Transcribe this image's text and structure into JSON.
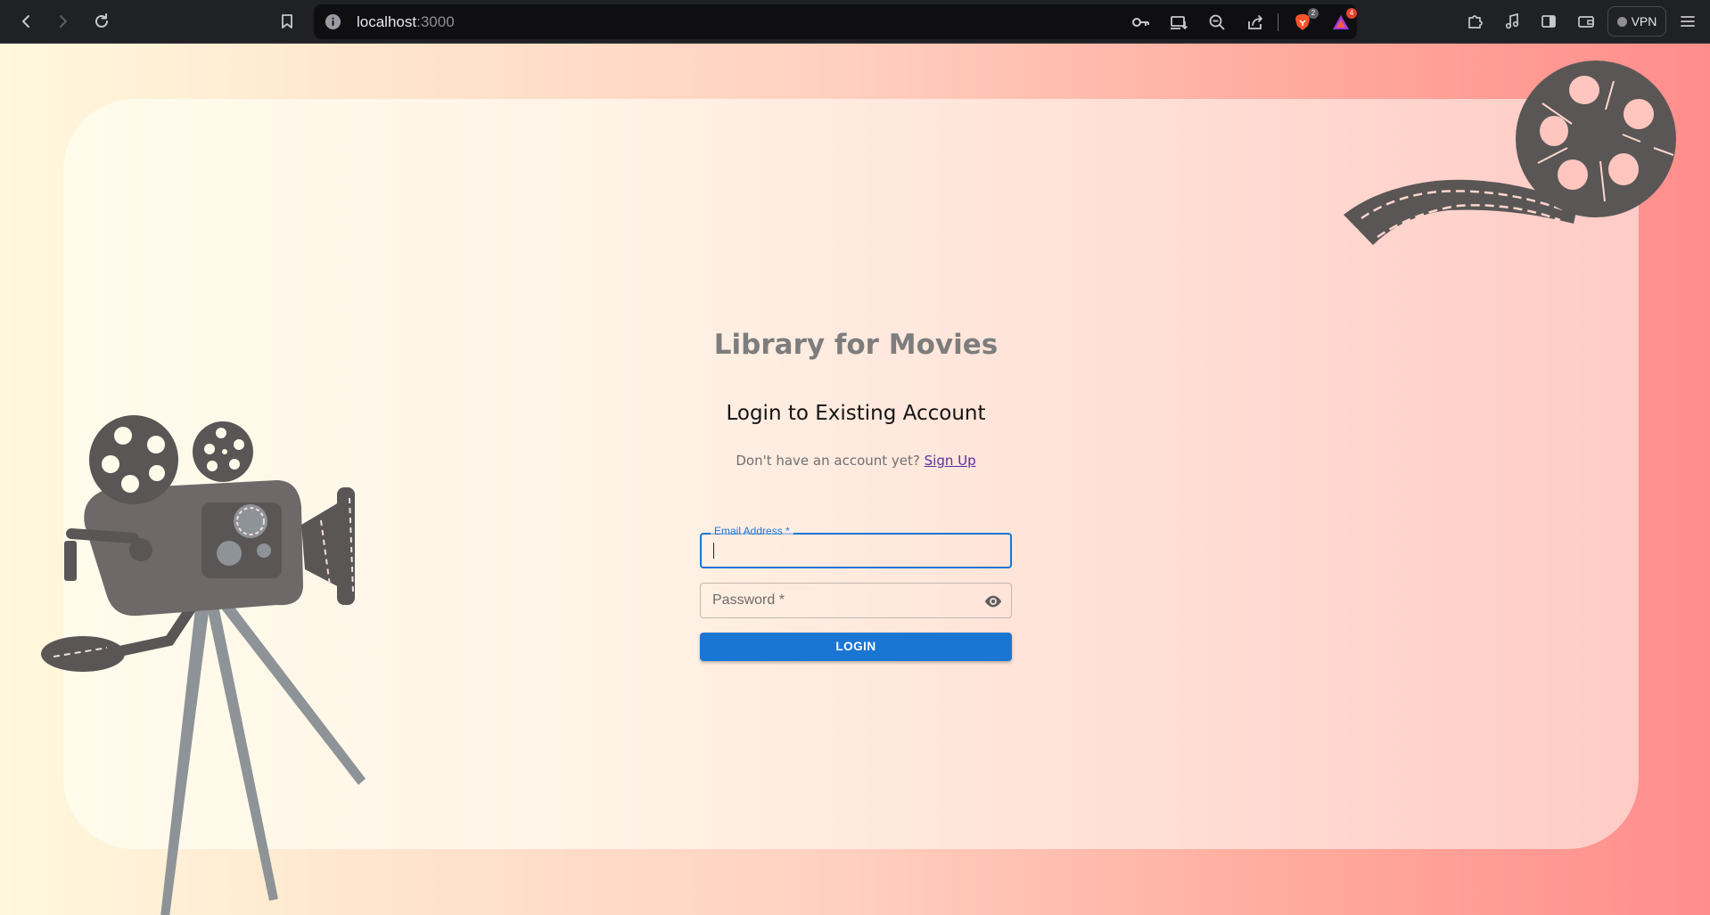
{
  "browser": {
    "url_host": "localhost",
    "url_port": ":3000",
    "brave_badge": "2",
    "rewards_badge": "4",
    "vpn_label": "VPN"
  },
  "page": {
    "app_title": "Library for Movies",
    "login_heading": "Login to Existing Account",
    "signup_prompt": "Don't have an account yet?",
    "signup_link": "Sign Up",
    "email_label": "Email Address *",
    "email_value": "",
    "password_placeholder": "Password *",
    "login_button": "LOGIN"
  },
  "colors": {
    "primary": "#1976d2",
    "decoration": "#5a5656",
    "tripod": "#8e9397"
  }
}
